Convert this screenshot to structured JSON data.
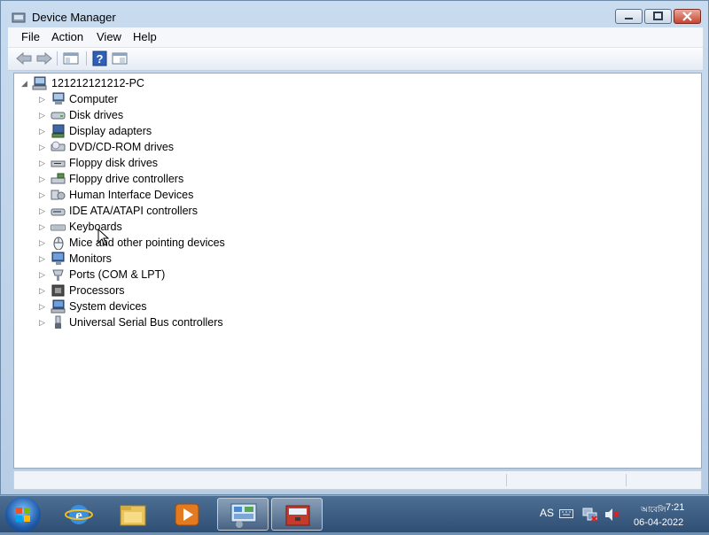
{
  "window": {
    "title": "Device Manager",
    "icon": "device-manager-icon"
  },
  "menu": [
    "File",
    "Action",
    "View",
    "Help"
  ],
  "toolbar": {
    "buttons": [
      "back-arrow-icon",
      "forward-arrow-icon",
      "show-hide-console-tree-icon",
      "help-icon",
      "properties-icon"
    ]
  },
  "tree": {
    "root": {
      "label": "121212121212-PC",
      "icon": "computer-root-icon",
      "expander": "◢"
    },
    "items": [
      {
        "label": "Computer",
        "icon": "computer-icon"
      },
      {
        "label": "Disk drives",
        "icon": "disk-drive-icon"
      },
      {
        "label": "Display adapters",
        "icon": "display-adapter-icon"
      },
      {
        "label": "DVD/CD-ROM drives",
        "icon": "dvd-drive-icon"
      },
      {
        "label": "Floppy disk drives",
        "icon": "floppy-drive-icon"
      },
      {
        "label": "Floppy drive controllers",
        "icon": "floppy-controller-icon"
      },
      {
        "label": "Human Interface Devices",
        "icon": "hid-icon"
      },
      {
        "label": "IDE ATA/ATAPI controllers",
        "icon": "ide-controller-icon"
      },
      {
        "label": "Keyboards",
        "icon": "keyboard-icon"
      },
      {
        "label": "Mice and other pointing devices",
        "icon": "mouse-icon"
      },
      {
        "label": "Monitors",
        "icon": "monitor-icon"
      },
      {
        "label": "Ports (COM & LPT)",
        "icon": "port-icon"
      },
      {
        "label": "Processors",
        "icon": "processor-icon"
      },
      {
        "label": "System devices",
        "icon": "system-device-icon"
      },
      {
        "label": "Universal Serial Bus controllers",
        "icon": "usb-icon"
      }
    ],
    "expander": "▷"
  },
  "taskbar": {
    "items": [
      "start-orb",
      "internet-explorer-icon",
      "file-explorer-icon",
      "media-player-icon",
      "control-panel-icon",
      "device-manager-taskbar-icon"
    ],
    "tray": {
      "language": "AS",
      "time": "7:21",
      "time_prefix": "আবেলি",
      "date": "06-04-2022"
    }
  },
  "colors": {
    "titlebar": "#c9dbee",
    "taskbar": "#2f4e73",
    "close": "#c8452f"
  }
}
